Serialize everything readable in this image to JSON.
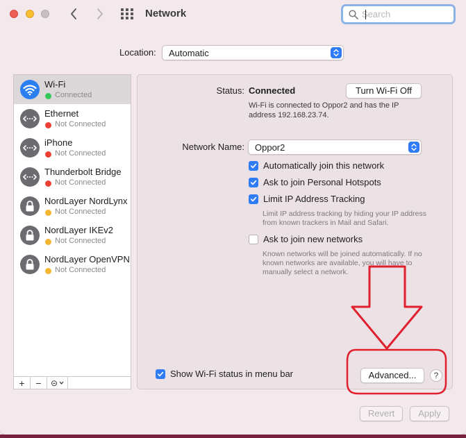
{
  "window": {
    "title": "Network"
  },
  "search": {
    "placeholder": "Search"
  },
  "location": {
    "label": "Location:",
    "value": "Automatic"
  },
  "services": [
    {
      "name": "Wi-Fi",
      "status": "Connected",
      "status_color": "#34c759",
      "icon": "wifi-icon",
      "selected": true
    },
    {
      "name": "Ethernet",
      "status": "Not Connected",
      "status_color": "#ec4037",
      "icon": "ethernet-icon"
    },
    {
      "name": "iPhone",
      "status": "Not Connected",
      "status_color": "#ec4037",
      "icon": "ethernet-icon"
    },
    {
      "name": "Thunderbolt Bridge",
      "status": "Not Connected",
      "status_color": "#ec4037",
      "icon": "ethernet-icon"
    },
    {
      "name": "NordLayer NordLynx",
      "status": "Not Connected",
      "status_color": "#f2b631",
      "icon": "lock-icon"
    },
    {
      "name": "NordLayer IKEv2",
      "status": "Not Connected",
      "status_color": "#f2b631",
      "icon": "lock-icon"
    },
    {
      "name": "NordLayer OpenVPN",
      "status": "Not Connected",
      "status_color": "#f2b631",
      "icon": "lock-icon"
    }
  ],
  "toolbar": {
    "add": "+",
    "remove": "−",
    "action": "⊝"
  },
  "detail": {
    "status_label": "Status:",
    "status_value": "Connected",
    "turn_off_label": "Turn Wi-Fi Off",
    "status_description": "Wi-Fi is connected to Oppor2 and has the IP address 192.168.23.74.",
    "network_name_label": "Network Name:",
    "network_name_value": "Oppor2",
    "options": [
      {
        "label": "Automatically join this network",
        "checked": true
      },
      {
        "label": "Ask to join Personal Hotspots",
        "checked": true
      },
      {
        "label": "Limit IP Address Tracking",
        "checked": true
      },
      {
        "label": "Ask to join new networks",
        "checked": false
      }
    ],
    "limit_hint": "Limit IP address tracking by hiding your IP address from known trackers in Mail and Safari.",
    "join_hint": "Known networks will be joined automatically. If no known networks are available, you will have to manually select a network.",
    "show_menubar_label": "Show Wi-Fi status in menu bar",
    "show_menubar_checked": true,
    "advanced_label": "Advanced...",
    "help_label": "?"
  },
  "footer": {
    "revert_label": "Revert",
    "apply_label": "Apply"
  },
  "colors": {
    "accent": "#2f7cf6",
    "annotation": "#e0202e"
  }
}
